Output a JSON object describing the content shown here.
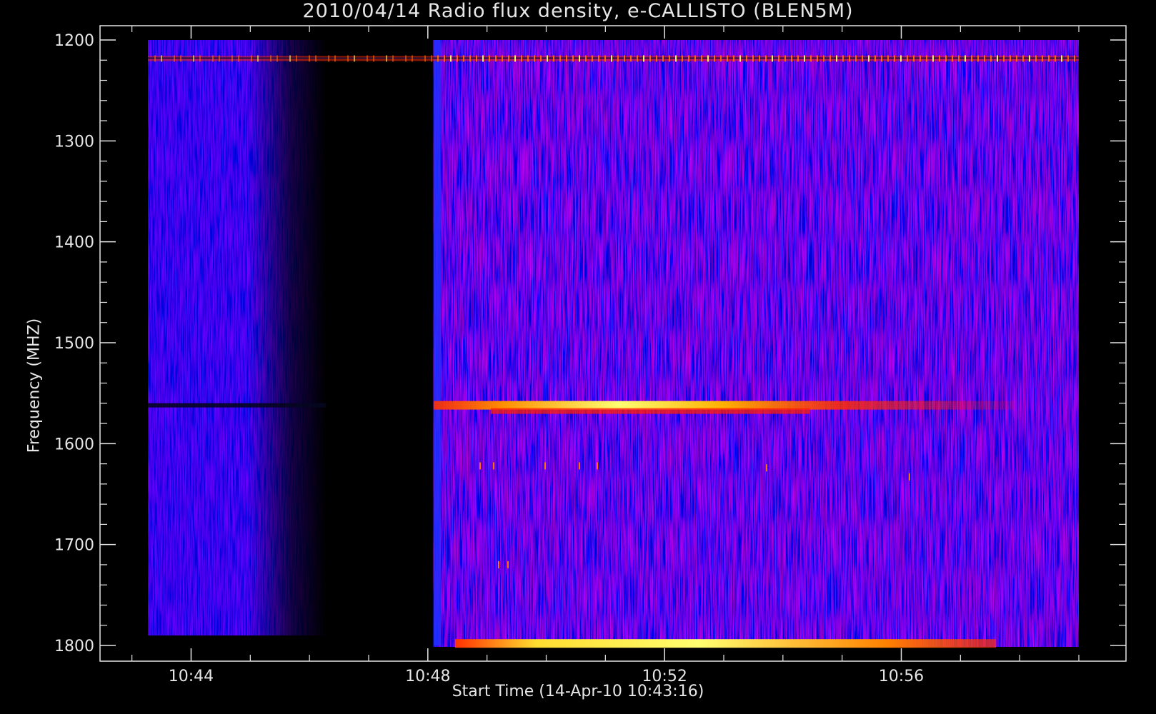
{
  "chart_data": {
    "type": "heatmap",
    "title": "2010/04/14  Radio flux density, e-CALLISTO (BLEN5M)",
    "xlabel": "Start Time (14-Apr-10 10:43:16)",
    "ylabel": "Frequency (MHZ)",
    "x_ticks": [
      "10:44",
      "10:48",
      "10:52",
      "10:56"
    ],
    "x_tick_minutes": [
      44,
      48,
      52,
      56
    ],
    "y_ticks": [
      1200,
      1300,
      1400,
      1500,
      1600,
      1700,
      1800
    ],
    "ylim": [
      1200,
      1800
    ],
    "xlim_minutes": [
      43.27,
      59.0
    ],
    "colors": {
      "background": "#000000",
      "low": "#1010ff",
      "mid": "#8a1fa0",
      "high": "#ff2000",
      "peak": "#ffff60"
    },
    "emission_bands": [
      {
        "freq_mhz": 1218,
        "intensity": "medium"
      },
      {
        "freq_mhz": 1562,
        "intensity": "high",
        "peak_time": "10:52"
      },
      {
        "freq_mhz": 1798,
        "intensity": "high",
        "peak_time": "10:52"
      }
    ],
    "data_gap": {
      "from": "10:47",
      "to": "10:48"
    }
  }
}
